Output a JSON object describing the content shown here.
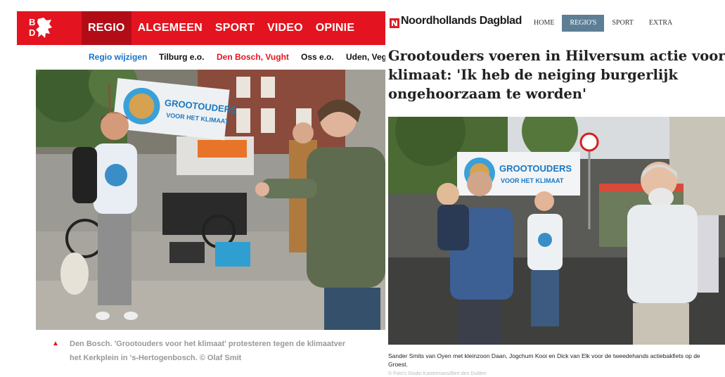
{
  "bd": {
    "logo_text": "BD",
    "nav": [
      "REGIO",
      "ALGEMEEN",
      "SPORT",
      "VIDEO",
      "OPINIE"
    ],
    "active_nav": "REGIO",
    "subnav": {
      "change": "Regio wijzigen",
      "items": [
        "Tilburg e.o.",
        "Den Bosch, Vught",
        "Oss e.o.",
        "Uden, Veg"
      ],
      "active": "Den Bosch, Vught"
    },
    "photo": {
      "banner_line1": "GROOTOUDERS",
      "banner_line2": "VOOR HET KLIMAAT"
    },
    "caption_line1": "Den Bosch. 'Grootouders voor het klimaat' protesteren tegen de klimaatver",
    "caption_line2": "het Kerkplein in 's-Hertogenbosch. © Olaf Smit"
  },
  "nhd": {
    "brand": "Noordhollands Dagblad",
    "nav": [
      "HOME",
      "REGIO'S",
      "SPORT",
      "EXTRA"
    ],
    "active_nav": "REGIO'S",
    "headline_line1": "Grootouders voeren in Hilversum actie voor het",
    "headline_line2": "klimaat: 'Ik heb de neiging burgerlijk",
    "headline_line3": "ongehoorzaam te worden'",
    "photo": {
      "banner_line1": "GROOTOUDERS",
      "banner_line2": "VOOR HET KLIMAAT"
    },
    "caption": "Sander Smits van Oyen met kleinzoon Daan, Jogchum Kooi en Dick van Elk voor de tweedehands actiebakfiets op de Groest.",
    "credit": "© Foto's Studio Kastermans/Bert den Dulden"
  },
  "colors": {
    "bd_red": "#e3141f",
    "bd_red_dark": "#b20d17",
    "bd_link_blue": "#1a73c9",
    "nhd_nav_active": "#5c7f95",
    "nhd_logo_red": "#e01b22"
  }
}
